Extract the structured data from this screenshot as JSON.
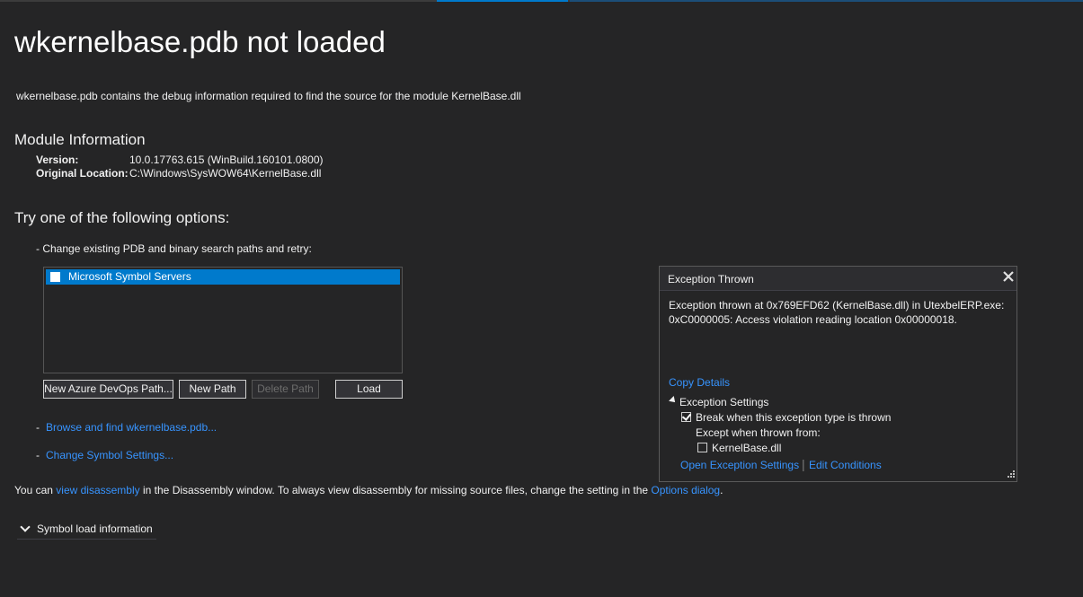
{
  "page": {
    "title": "wkernelbase.pdb not loaded",
    "description": "wkernelbase.pdb contains the debug information required to find the source for the module KernelBase.dll"
  },
  "module_info": {
    "heading": "Module Information",
    "version_label": "Version:",
    "version_value": "10.0.17763.615 (WinBuild.160101.0800)",
    "location_label": "Original Location:",
    "location_value": "C:\\Windows\\SysWOW64\\KernelBase.dll"
  },
  "options": {
    "heading": "Try one of the following options:",
    "change_paths_text": "-  Change existing PDB and binary search paths and retry:",
    "path_list": [
      {
        "label": "Microsoft Symbol Servers",
        "checked": false,
        "selected": true
      }
    ],
    "buttons": {
      "new_azure": "New Azure DevOps Path...",
      "new_path": "New Path",
      "delete_path": "Delete Path",
      "load": "Load"
    },
    "dash": "-",
    "browse_link": "Browse and find wkernelbase.pdb...",
    "symbol_settings_link": "Change Symbol Settings..."
  },
  "footer": {
    "prefix": "You can",
    "view_disassembly_link": "view disassembly",
    "middle": "in the Disassembly window. To always view disassembly for missing source files, change the setting in the",
    "options_link": "Options dialog",
    "suffix": "."
  },
  "symbol_load": {
    "label": "Symbol load information"
  },
  "exception_popup": {
    "title": "Exception Thrown",
    "message_line1": "Exception thrown at 0x769EFD62 (KernelBase.dll) in UtexbelERP.exe:",
    "message_line2": "0xC0000005: Access violation reading location 0x00000018.",
    "copy_details": "Copy Details",
    "settings_heading": "Exception Settings",
    "break_when_thrown": "Break when this exception type is thrown",
    "break_checked": true,
    "except_when": "Except when thrown from:",
    "except_module": "KernelBase.dll",
    "except_module_checked": false,
    "open_settings": "Open Exception Settings",
    "separator": "|",
    "edit_conditions": "Edit Conditions"
  },
  "colors": {
    "background": "#252526",
    "accent": "#007acc",
    "link": "#3794ff"
  }
}
